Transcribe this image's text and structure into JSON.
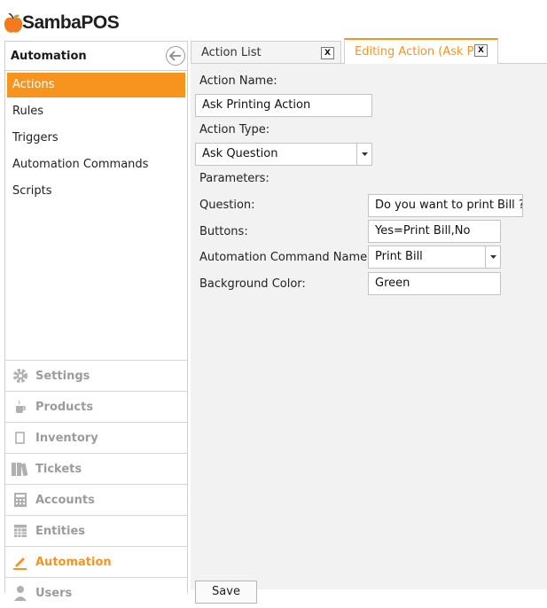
{
  "app": {
    "brand": "SambaPOS"
  },
  "sidebar": {
    "title": "Automation",
    "items": [
      {
        "label": "Actions",
        "active": true
      },
      {
        "label": "Rules"
      },
      {
        "label": "Triggers"
      },
      {
        "label": "Automation Commands"
      },
      {
        "label": "Scripts"
      }
    ],
    "modules": [
      {
        "label": "Settings",
        "icon": "gear-icon"
      },
      {
        "label": "Products",
        "icon": "cup-icon"
      },
      {
        "label": "Inventory",
        "icon": "box-icon"
      },
      {
        "label": "Tickets",
        "icon": "tickets-icon"
      },
      {
        "label": "Accounts",
        "icon": "calculator-icon"
      },
      {
        "label": "Entities",
        "icon": "entities-icon"
      },
      {
        "label": "Automation",
        "icon": "pen-icon",
        "active": true
      },
      {
        "label": "Users",
        "icon": "user-icon"
      }
    ]
  },
  "tabs": [
    {
      "label": "Action List",
      "close": "X"
    },
    {
      "label": "Editing Action (Ask Printing Action)",
      "close": "X",
      "active": true
    }
  ],
  "form": {
    "action_name_label": "Action Name:",
    "action_name_value": "Ask Printing Action",
    "action_type_label": "Action Type:",
    "action_type_value": "Ask Question",
    "parameters_label": "Parameters:",
    "params": [
      {
        "label": "Question:",
        "value": "Do you want to print Bill ?"
      },
      {
        "label": "Buttons:",
        "value": "Yes=Print Bill,No"
      },
      {
        "label": "Automation Command Name:",
        "value": "Print Bill"
      },
      {
        "label": "Background Color:",
        "value": "Green"
      }
    ],
    "save_label": "Save"
  },
  "colors": {
    "accent": "#f7941d",
    "panel_bg": "#f2f2f2"
  }
}
